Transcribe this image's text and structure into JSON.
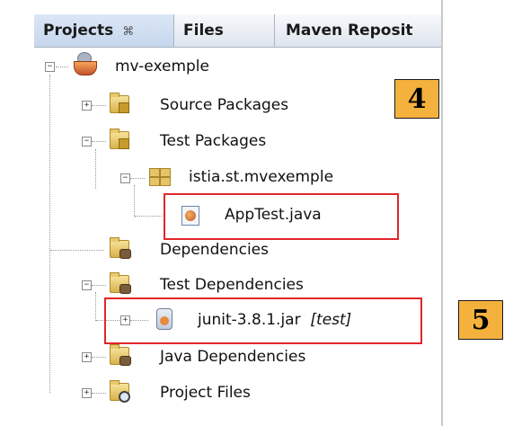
{
  "tabs": [
    {
      "label": "Projects",
      "close": "⌘"
    },
    {
      "label": "Files"
    },
    {
      "label": "Maven Reposit"
    }
  ],
  "tree": {
    "project": "mv-exemple",
    "source_packages": "Source Packages",
    "test_packages": "Test Packages",
    "package": "istia.st.mvexemple",
    "test_file": "AppTest.java",
    "dependencies": "Dependencies",
    "test_dependencies": "Test Dependencies",
    "jar_name": "junit-3.8.1.jar",
    "jar_scope": "[test]",
    "java_dependencies": "Java Dependencies",
    "project_files": "Project Files"
  },
  "callouts": {
    "one": "4",
    "two": "5"
  },
  "colors": {
    "highlight": "#e0262a",
    "callout": "#f5b13d"
  }
}
